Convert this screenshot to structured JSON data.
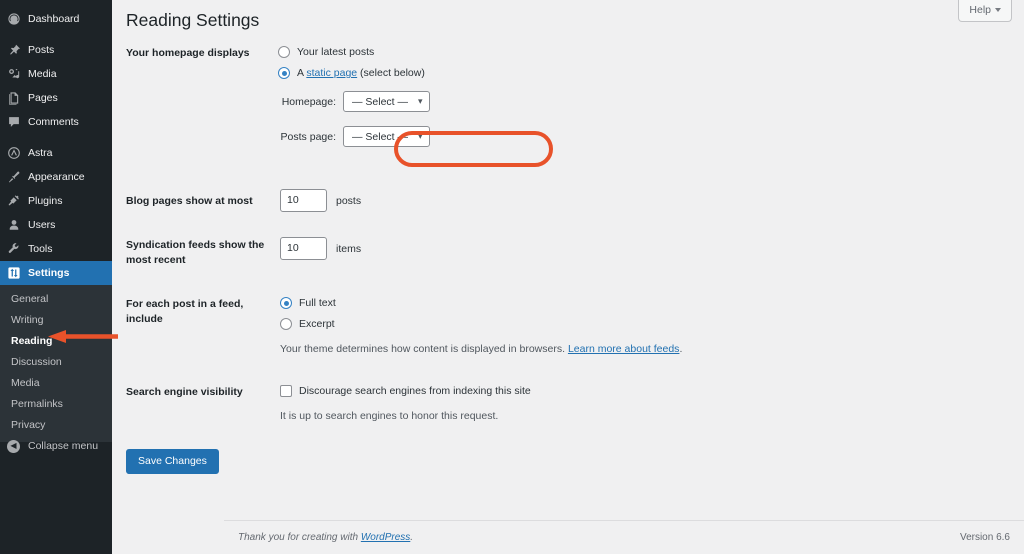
{
  "sidebar": {
    "items": [
      {
        "label": "Dashboard",
        "icon": "dashboard-icon",
        "name": "dashboard"
      },
      {
        "label": "Posts",
        "icon": "pin-icon",
        "name": "posts"
      },
      {
        "label": "Media",
        "icon": "media-icon",
        "name": "media"
      },
      {
        "label": "Pages",
        "icon": "pages-icon",
        "name": "pages"
      },
      {
        "label": "Comments",
        "icon": "comments-icon",
        "name": "comments"
      },
      {
        "label": "Astra",
        "icon": "astra-icon",
        "name": "astra"
      },
      {
        "label": "Appearance",
        "icon": "paintbrush-icon",
        "name": "appearance"
      },
      {
        "label": "Plugins",
        "icon": "plug-icon",
        "name": "plugins"
      },
      {
        "label": "Users",
        "icon": "user-icon",
        "name": "users"
      },
      {
        "label": "Tools",
        "icon": "wrench-icon",
        "name": "tools"
      },
      {
        "label": "Settings",
        "icon": "settings-sliders-icon",
        "name": "settings",
        "current": true
      }
    ],
    "submenu": [
      {
        "label": "General"
      },
      {
        "label": "Writing"
      },
      {
        "label": "Reading",
        "current": true
      },
      {
        "label": "Discussion"
      },
      {
        "label": "Media"
      },
      {
        "label": "Permalinks"
      },
      {
        "label": "Privacy"
      }
    ],
    "collapse_label": "Collapse menu"
  },
  "header": {
    "page_title": "Reading Settings",
    "help_label": "Help"
  },
  "settings": {
    "homepage_displays": {
      "label": "Your homepage displays",
      "option_latest": "Your latest posts",
      "option_static_prefix": "A ",
      "option_static_link": "static page",
      "option_static_suffix": " (select below)",
      "selected": "static"
    },
    "homepage_select": {
      "label": "Homepage:",
      "value": "— Select —"
    },
    "posts_page_select": {
      "label": "Posts page:",
      "value": "— Select —"
    },
    "blog_pages": {
      "label": "Blog pages show at most",
      "value": "10",
      "unit": "posts"
    },
    "syndication_feeds": {
      "label": "Syndication feeds show the most recent",
      "value": "10",
      "unit": "items"
    },
    "feed_include": {
      "label": "For each post in a feed, include",
      "option_full": "Full text",
      "option_excerpt": "Excerpt",
      "selected": "full",
      "description_prefix": "Your theme determines how content is displayed in browsers. ",
      "description_link": "Learn more about feeds",
      "description_suffix": "."
    },
    "search_visibility": {
      "label": "Search engine visibility",
      "checkbox_label": "Discourage search engines from indexing this site",
      "checked": false,
      "description": "It is up to search engines to honor this request."
    },
    "save_label": "Save Changes"
  },
  "footer": {
    "thanks_prefix": "Thank you for creating with ",
    "thanks_link": "WordPress",
    "thanks_suffix": ".",
    "version": "Version 6.6"
  },
  "annotations": {
    "highlight_color": "#E8522A",
    "highlight_target": "posts-page-select",
    "arrow_target": "submenu-item-reading"
  },
  "colors": {
    "admin_bg": "#1d2327",
    "submenu_bg": "#2c3338",
    "accent_blue": "#2271b1",
    "content_bg": "#f0f0f1",
    "annotation": "#E8522A"
  }
}
